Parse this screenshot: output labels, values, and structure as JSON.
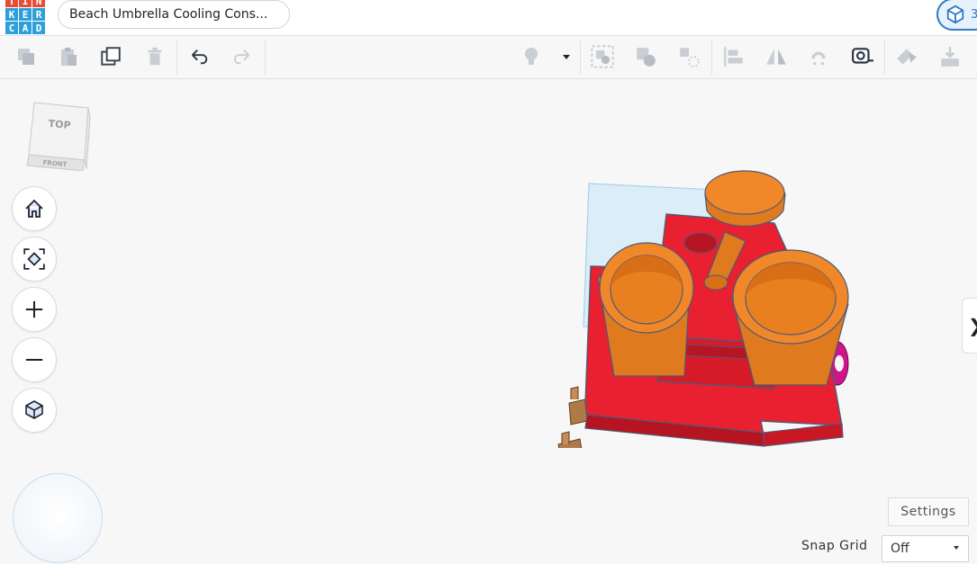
{
  "app": {
    "logo_letters": [
      "T",
      "I",
      "N",
      "K",
      "E",
      "R",
      "C",
      "A",
      "D"
    ],
    "logo_colors": [
      "#e84e35",
      "#e84e35",
      "#e84e35",
      "#2ea0d9",
      "#2ea0d9",
      "#2ea0d9",
      "#2ea0d9",
      "#2ea0d9",
      "#2ea0d9"
    ],
    "design_title": "Beach Umbrella Cooling Cons...",
    "header_right_label": "3"
  },
  "toolbar": {
    "left_icons": [
      "copy-icon",
      "paste-icon",
      "duplicate-icon",
      "delete-icon",
      "undo-icon",
      "redo-icon"
    ],
    "right_icons": [
      "light-bulb-icon",
      "dropdown-caret-icon",
      "group-icon",
      "ungroup-icon",
      "hole-icon",
      "align-icon",
      "mirror-icon",
      "cruise-icon",
      "ruler-icon",
      "export-icon",
      "import-icon"
    ]
  },
  "viewcube": {
    "top_label": "TOP",
    "front_label": "FRONT"
  },
  "nav_buttons": [
    "home-view",
    "fit-view",
    "zoom-in",
    "zoom-out",
    "perspective-toggle"
  ],
  "bottom_right": {
    "settings_label": "Settings",
    "snap_grid_label": "Snap Grid",
    "snap_grid_value": "Off"
  },
  "colors": {
    "accent": "#2d7ac7",
    "body_red": "#e8202f",
    "cup_orange": "#f0882a",
    "workplane": "#cfe8f6"
  }
}
